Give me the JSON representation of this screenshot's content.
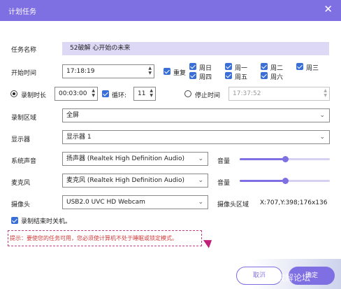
{
  "dialog": {
    "title": "计划任务"
  },
  "task_name": {
    "label": "任务名称",
    "value": "52破解 心开始の未来"
  },
  "start_time": {
    "label": "开始时间",
    "value": "17:18:19",
    "repeat_label": "重复",
    "days": [
      "周日",
      "周一",
      "周二",
      "周三",
      "周四",
      "周五",
      "周六"
    ]
  },
  "duration": {
    "label": "录制时长",
    "value": "00:03:00",
    "loop_label": "循环:",
    "loop_value": "11",
    "stop_label": "停止时间",
    "stop_value": "17:37:52"
  },
  "region": {
    "label": "录制区域",
    "value": "全屏"
  },
  "display": {
    "label": "显示器",
    "value": "显示器 1"
  },
  "system_audio": {
    "label": "系统声音",
    "value": "扬声器 (Realtek High Definition Audio)",
    "volume_label": "音量",
    "volume_level": 0.5
  },
  "microphone": {
    "label": "麦克风",
    "value": "麦克风 (Realtek High Definition Audio)",
    "volume_label": "音量",
    "volume_level": 0.5
  },
  "camera": {
    "label": "摄像头",
    "value": "USB2.0 UVC HD Webcam",
    "region_label": "摄像头区域",
    "region_value": "X:707,Y:398;176x136"
  },
  "shutdown": {
    "label": "录制结束时关机。"
  },
  "hint": "提示：要使您的任务可用，您必须使计算机不处于睡眠或锁定模式。",
  "buttons": {
    "cancel": "取消",
    "ok": "确定"
  },
  "watermark": "吾爱破解论坛",
  "colors": {
    "accent": "#7e6fe3",
    "hint_text": "#d03a3a",
    "hint_border": "#c23c86"
  }
}
